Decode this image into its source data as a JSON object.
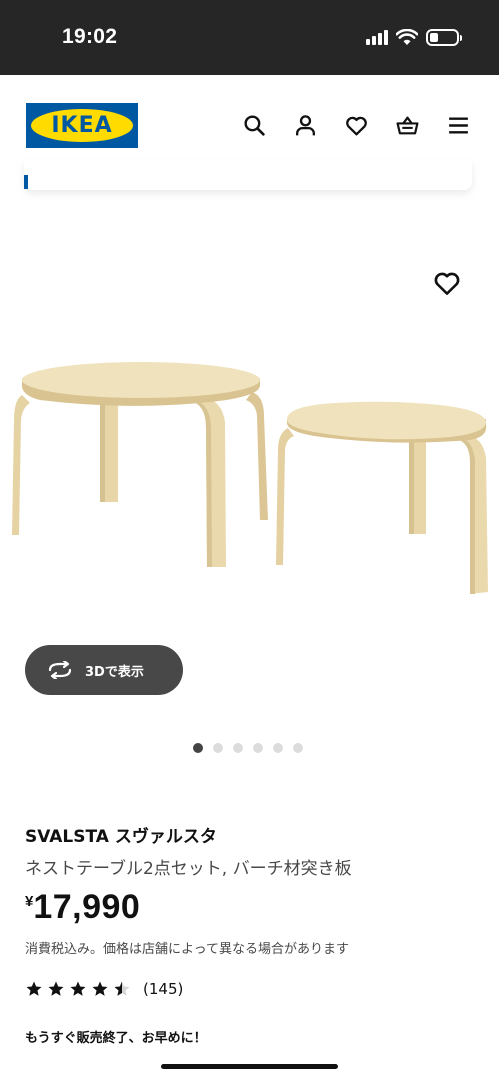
{
  "status_bar": {
    "time": "19:02",
    "icons": [
      "cellular-signal-icon",
      "wifi-icon",
      "battery-icon"
    ]
  },
  "header": {
    "logo_text": "IKEA",
    "brand_colors": {
      "blue": "#0058a3",
      "yellow": "#ffdb00"
    },
    "icons": [
      "search-icon",
      "account-icon",
      "wishlist-heart-icon",
      "shopping-bag-icon",
      "menu-icon"
    ]
  },
  "gallery": {
    "favorite_icon": "heart-outline-icon",
    "view_3d_label": "3Dで表示",
    "view_3d_icon": "rotate-arrows-icon",
    "dots_total": 6,
    "active_dot": 0
  },
  "product": {
    "name": "SVALSTA スヴァルスタ",
    "description": "ネストテーブル2点セット, バーチ材突き板",
    "price_currency": "¥",
    "price_value": "17,990",
    "tax_note": "消費税込み。価格は店舗によって異なる場合があります",
    "rating": 4.5,
    "rating_max": 5,
    "review_count": "(145)",
    "ending_soon": "もうすぐ販売終了、お早めに！"
  }
}
